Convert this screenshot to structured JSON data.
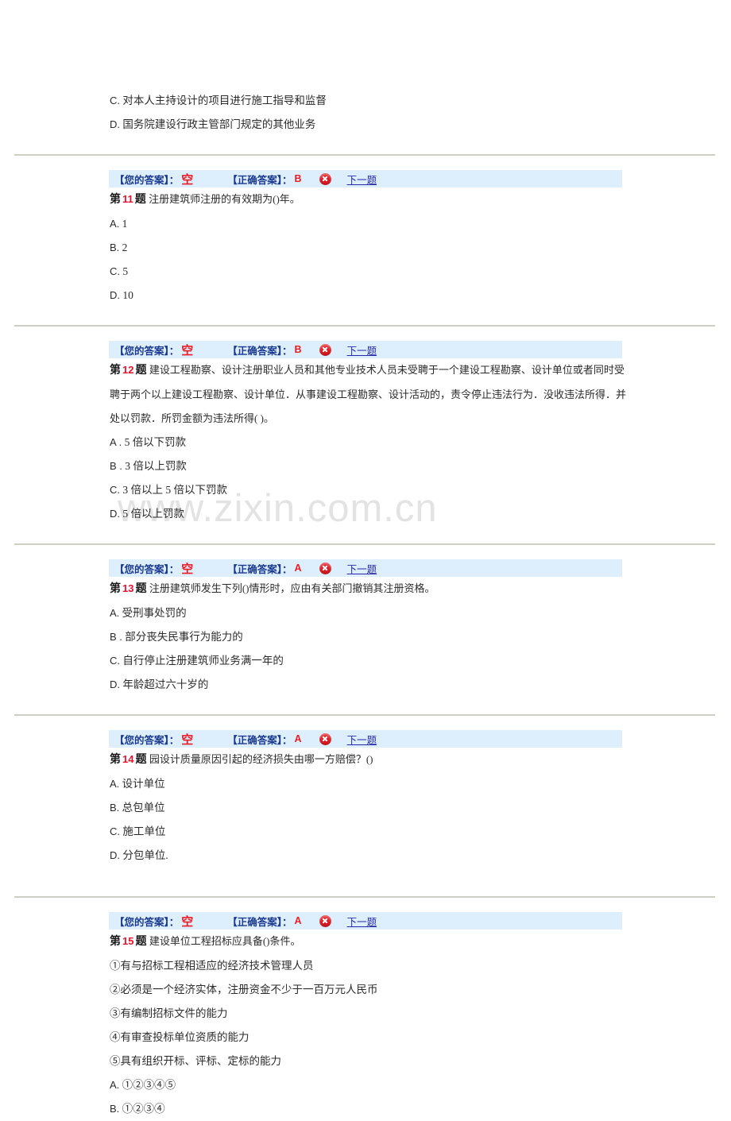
{
  "watermark": "www.zixin.com.cn",
  "labels": {
    "your_answer": "【您的答案】：",
    "correct_answer": "【正确答案】：",
    "next_question": "下一题",
    "question_prefix": "第",
    "question_suffix": "题",
    "result_icon": "error-cross-icon"
  },
  "colors": {
    "bar_bg": "#ddeefc",
    "label_blue": "#1b3a8f",
    "answer_red": "#ed1c24",
    "qnum_red": "#e8112d",
    "link_blue": "#2a2aa8",
    "rule_gray": "#cfcec4",
    "watermark_gray": "#e3e3e3"
  },
  "top_fragment": {
    "options": [
      {
        "label": "C.",
        "text": "对本人主持设计的项目进行施工指导和监督"
      },
      {
        "label": "D.",
        "text": "国务院建设行政主管部门规定的其他业务"
      }
    ]
  },
  "questions": [
    {
      "number": "11",
      "your_answer": "空",
      "correct_answer": "B",
      "stem": "注册建筑师注册的有效期为()年。",
      "options": [
        {
          "label": "A.",
          "text": "1"
        },
        {
          "label": "B.",
          "text": "2"
        },
        {
          "label": "C.",
          "text": "5"
        },
        {
          "label": "D.",
          "text": "10"
        }
      ]
    },
    {
      "number": "12",
      "your_answer": "空",
      "correct_answer": "B",
      "stem": "建设工程勘察、设计注册职业人员和其他专业技术人员未受聘于一个建设工程勘察、设计单位或者同时受聘于两个以上建设工程勘察、设计单位．从事建设工程勘察、设计活动的，责令停止违法行为．没收违法所得．并处以罚款．所罚金额为违法所得( )。",
      "options": [
        {
          "label": "A .",
          "text": "5 倍以下罚款"
        },
        {
          "label": "B .",
          "text": "3 倍以上罚款"
        },
        {
          "label": "C.",
          "text": " 3 倍以上 5 倍以下罚款"
        },
        {
          "label": "D.",
          "text": " 5 倍以上罚款"
        }
      ]
    },
    {
      "number": "13",
      "your_answer": "空",
      "correct_answer": "A",
      "stem": "注册建筑师发生下列()情形时，应由有关部门撤销其注册资格。",
      "options": [
        {
          "label": "A.",
          "text": "受刑事处罚的"
        },
        {
          "label": "B .",
          "text": "部分丧失民事行为能力的"
        },
        {
          "label": "C.",
          "text": "自行停止注册建筑师业务满一年的"
        },
        {
          "label": "D.",
          "text": "年龄超过六十岁的"
        }
      ]
    },
    {
      "number": "14",
      "your_answer": "空",
      "correct_answer": "A",
      "stem": "园设计质量原因引起的经济损失由哪一方赔偿？()",
      "options": [
        {
          "label": "A.",
          "text": "设计单位"
        },
        {
          "label": "B.",
          "text": "总包单位"
        },
        {
          "label": "C.",
          "text": "施工单位"
        },
        {
          "label": "D.",
          "text": "分包单位."
        }
      ]
    },
    {
      "number": "15",
      "your_answer": "空",
      "correct_answer": "A",
      "stem": "建设单位工程招标应具备()条件。",
      "conditions": [
        "①有与招标工程相适应的经济技术管理人员",
        "②必须是一个经济实体，注册资金不少于一百万元人民币",
        "③有编制招标文件的能力",
        "④有审查投标单位资质的能力",
        "⑤具有组织开标、评标、定标的能力"
      ],
      "options": [
        {
          "label": "A.",
          "text": "①②③④⑤"
        },
        {
          "label": "B.",
          "text": "①②③④"
        }
      ]
    }
  ]
}
